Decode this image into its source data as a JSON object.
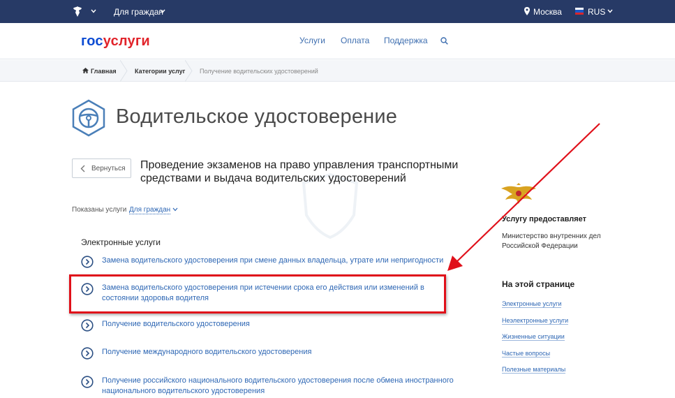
{
  "topbar": {
    "for_citizens": "Для граждан",
    "city": "Москва",
    "lang": "RUS",
    "icons": [
      "emblem-icon",
      "chevron-down-icon",
      "location-pin-icon",
      "flag-icon"
    ]
  },
  "header": {
    "logo_part1": "гос",
    "logo_part2": "услуги",
    "nav": [
      "Услуги",
      "Оплата",
      "Поддержка"
    ]
  },
  "breadcrumb": {
    "home": "Главная",
    "categories": "Категории услуг",
    "current": "Получение водительских удостоверений"
  },
  "page": {
    "title": "Водительское удостоверение",
    "back": "Вернуться",
    "service_title": "Проведение экзаменов на право управления транспортными средствами и выдача водительских удостоверений",
    "shown_label": "Показаны услуги",
    "shown_value": "Для граждан",
    "section_title": "Электронные услуги",
    "services": [
      "Замена водительского удостоверения при смене данных владельца, утрате или непригодности",
      "Замена водительского удостоверения при истечении срока его действия или изменений в состоянии здоровья водителя",
      "Получение водительского удостоверения",
      "Получение международного водительского удостоверения",
      "Получение российского национального водительского удостоверения после обмена иностранного национального водительского удостоверения"
    ]
  },
  "sidebar": {
    "provider_heading": "Услугу предоставляет",
    "provider": "Министерство внутренних дел Российской Федерации",
    "onpage_heading": "На этой странице",
    "links": [
      "Электронные услуги",
      "Неэлектронные услуги",
      "Жизненные ситуации",
      "Частые вопросы",
      "Полезные материалы"
    ]
  },
  "colors": {
    "topbar": "#273a66",
    "brand_blue": "#0d4cd3",
    "brand_red": "#e1232a",
    "link": "#2e67b4",
    "annotation_red": "#e0101a"
  }
}
